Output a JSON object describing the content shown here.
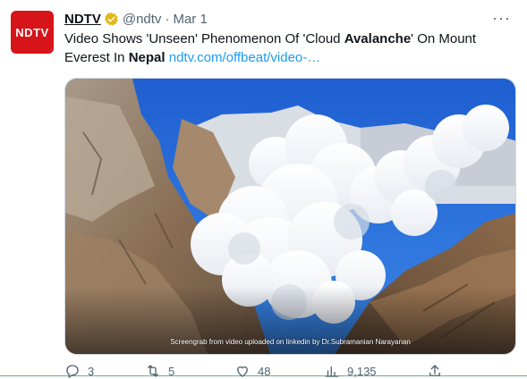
{
  "tweet": {
    "avatar_text": "NDTV",
    "author_name": "NDTV",
    "handle": "@ndtv",
    "separator": "·",
    "date": "Mar 1",
    "more_label": "···",
    "text_parts": {
      "p1": "Video Shows 'Unseen' Phenomenon Of 'Cloud ",
      "p2": "Avalanche",
      "p3": "' On Mount Everest In ",
      "p4": "Nepal",
      "link": "ndtv.com/offbeat/video-…"
    },
    "media_caption": "Screengrab from video uploaded on linkedin by Dr.Subramanian Narayanan",
    "actions": {
      "replies": "3",
      "retweets": "5",
      "likes": "48",
      "views": "9,135"
    }
  },
  "colors": {
    "brand": "#d7141a",
    "link": "#1d9bf0",
    "verified": "#e2b719",
    "muted": "#536471"
  }
}
